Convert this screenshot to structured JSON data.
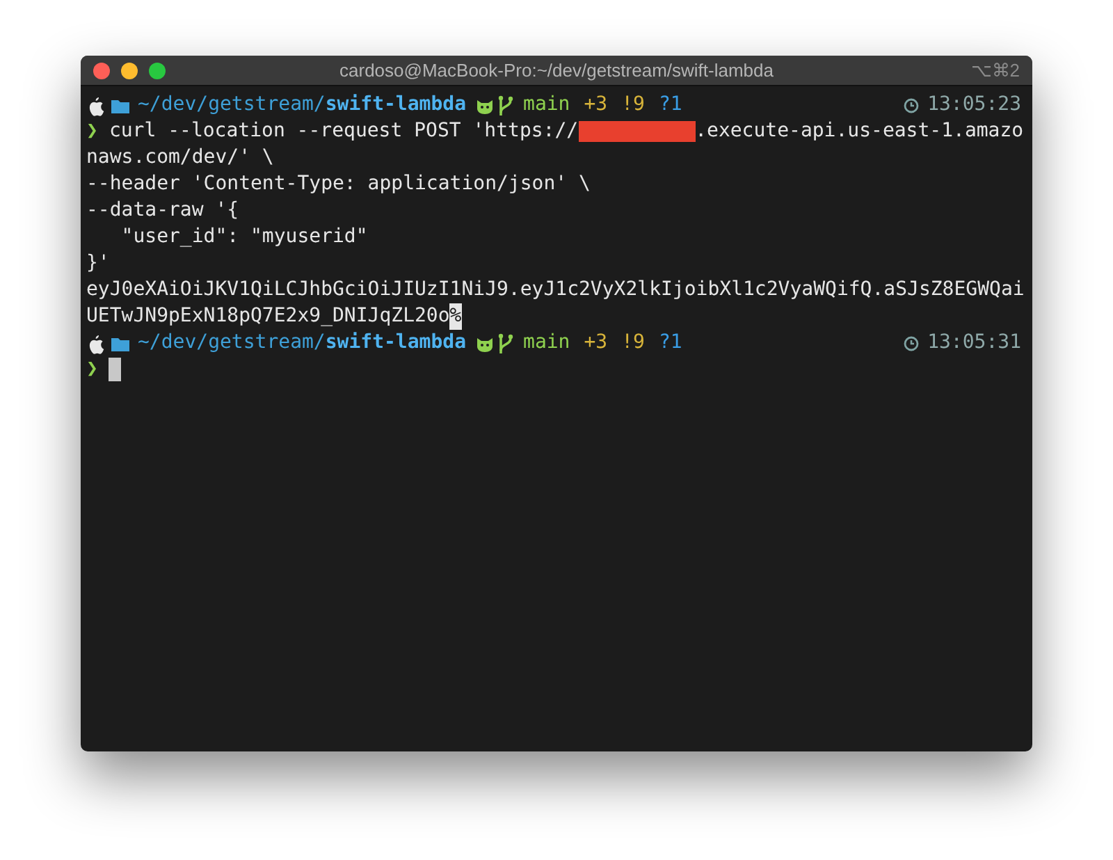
{
  "window": {
    "title": "cardoso@MacBook-Pro:~/dev/getstream/swift-lambda",
    "shortcut": "⌥⌘2"
  },
  "lines": [
    {
      "kind": "prompt",
      "path": "~/dev/getstream/",
      "dir": "swift-lambda",
      "branch": "main",
      "staged": "+3",
      "modified": "!9",
      "untracked": "?1",
      "time": "13:05:23"
    },
    {
      "kind": "command",
      "symbol": "❯",
      "before": "curl --location --request POST 'https://",
      "redacted": true,
      "after": ".execute-api.us-east-1.amazo"
    },
    {
      "kind": "text",
      "text": "naws.com/dev/' \\"
    },
    {
      "kind": "text",
      "text": "--header 'Content-Type: application/json' \\"
    },
    {
      "kind": "text",
      "text": "--data-raw '{"
    },
    {
      "kind": "text",
      "text": "   \"user_id\": \"myuserid\""
    },
    {
      "kind": "text",
      "text": "}'"
    },
    {
      "kind": "text",
      "text": "eyJ0eXAiOiJKV1QiLCJhbGciOiJIUzI1NiJ9.eyJ1c2VyX2lkIjoibXl1c2VyaWQifQ.aSJsZ8EGWQai"
    },
    {
      "kind": "text",
      "text": "UETwJN9pExN18pQ7E2x9_DNIJqZL20o",
      "marker": "%"
    },
    {
      "kind": "prompt",
      "path": "~/dev/getstream/",
      "dir": "swift-lambda",
      "branch": "main",
      "staged": "+3",
      "modified": "!9",
      "untracked": "?1",
      "time": "13:05:31"
    },
    {
      "kind": "input",
      "symbol": "❯",
      "cursor": true
    }
  ]
}
